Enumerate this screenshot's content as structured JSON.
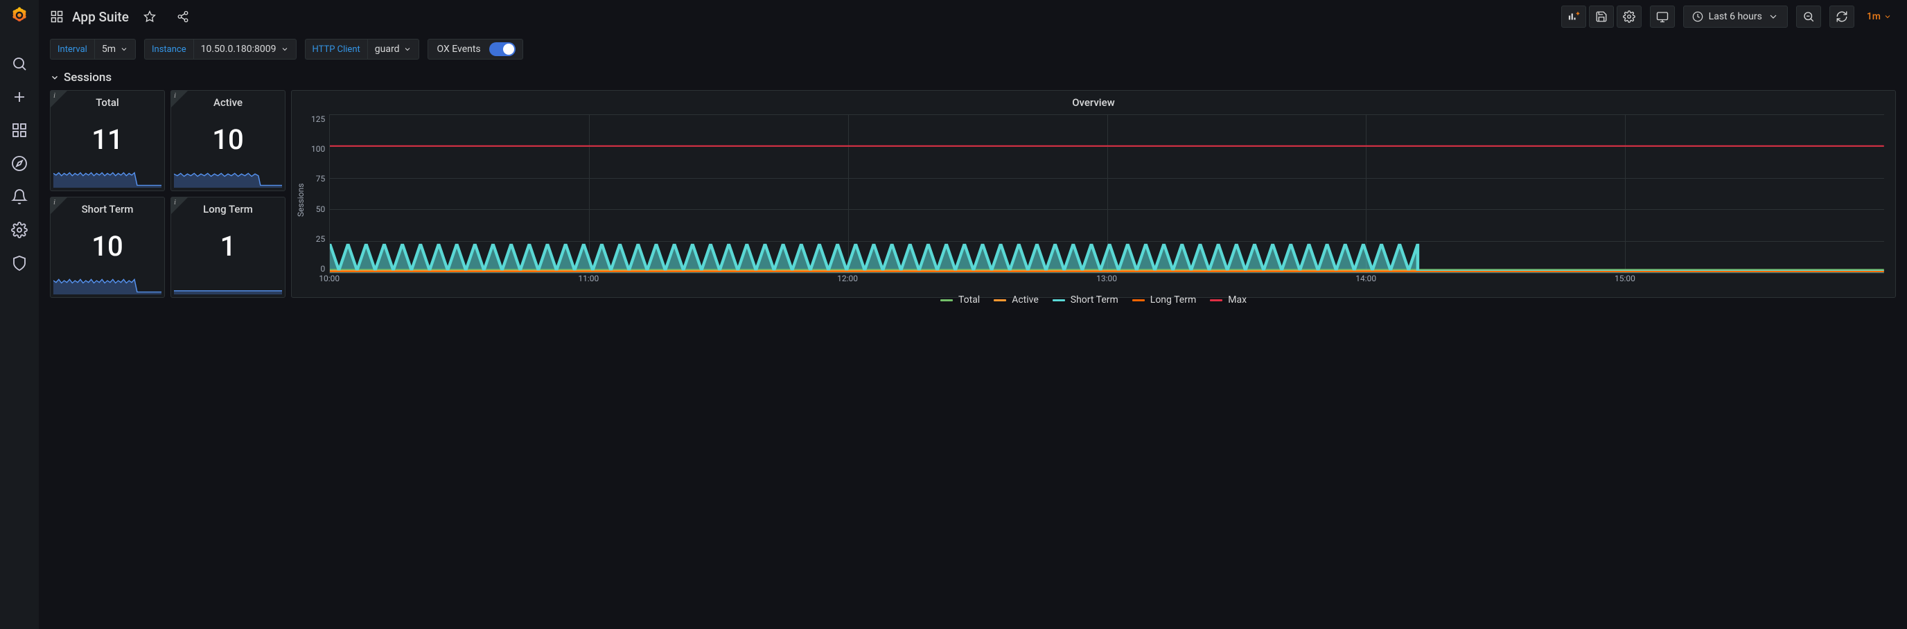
{
  "page_title": "App Suite",
  "time_range_label": "Last 6 hours",
  "refresh_interval": "1m",
  "variables": {
    "interval": {
      "label": "Interval",
      "value": "5m"
    },
    "instance": {
      "label": "Instance",
      "value": "10.50.0.180:8009"
    },
    "http_client": {
      "label": "HTTP Client",
      "value": "guard"
    },
    "ox_events": {
      "label": "OX Events",
      "enabled": true
    }
  },
  "row_title": "Sessions",
  "stats": {
    "total": {
      "title": "Total",
      "value": "11"
    },
    "active": {
      "title": "Active",
      "value": "10"
    },
    "short_term": {
      "title": "Short Term",
      "value": "10"
    },
    "long_term": {
      "title": "Long Term",
      "value": "1"
    }
  },
  "chart": {
    "title": "Overview",
    "y_label": "Sessions",
    "y_ticks": [
      "125",
      "100",
      "75",
      "50",
      "25",
      "0"
    ],
    "x_ticks": [
      "10:00",
      "11:00",
      "12:00",
      "13:00",
      "14:00",
      "15:00"
    ],
    "legend": {
      "total": "Total",
      "active": "Active",
      "short_term": "Short Term",
      "long_term": "Long Term",
      "max": "Max"
    }
  },
  "chart_data": {
    "type": "line",
    "title": "Overview",
    "xlabel": "",
    "ylabel": "Sessions",
    "ylim": [
      0,
      125
    ],
    "x_range_hours": [
      "10:00",
      "16:00"
    ],
    "series": [
      {
        "name": "Max",
        "value_constant": 100,
        "color": "#e02f44"
      },
      {
        "name": "Total",
        "approx_range": [
          3,
          25
        ],
        "drops_to": 3,
        "drop_at": "14:10",
        "oscillating": true,
        "color": "#73bf69"
      },
      {
        "name": "Active",
        "approx_range": [
          2,
          24
        ],
        "drops_to": 2,
        "drop_at": "14:10",
        "oscillating": true,
        "color": "#ff9830"
      },
      {
        "name": "Short Term",
        "approx_range": [
          1,
          23
        ],
        "drops_to": 2,
        "drop_at": "14:10",
        "oscillating": true,
        "color": "#5ad8d5"
      },
      {
        "name": "Long Term",
        "value_constant": 1,
        "color": "#fa6400"
      }
    ],
    "note": "Total/Active/Short Term oscillate rapidly between approx 2 and 24 sessions from 10:00 until about 14:10, then drop to near-zero steady state. Max is a flat line at 100. Long Term is flat near 1."
  }
}
